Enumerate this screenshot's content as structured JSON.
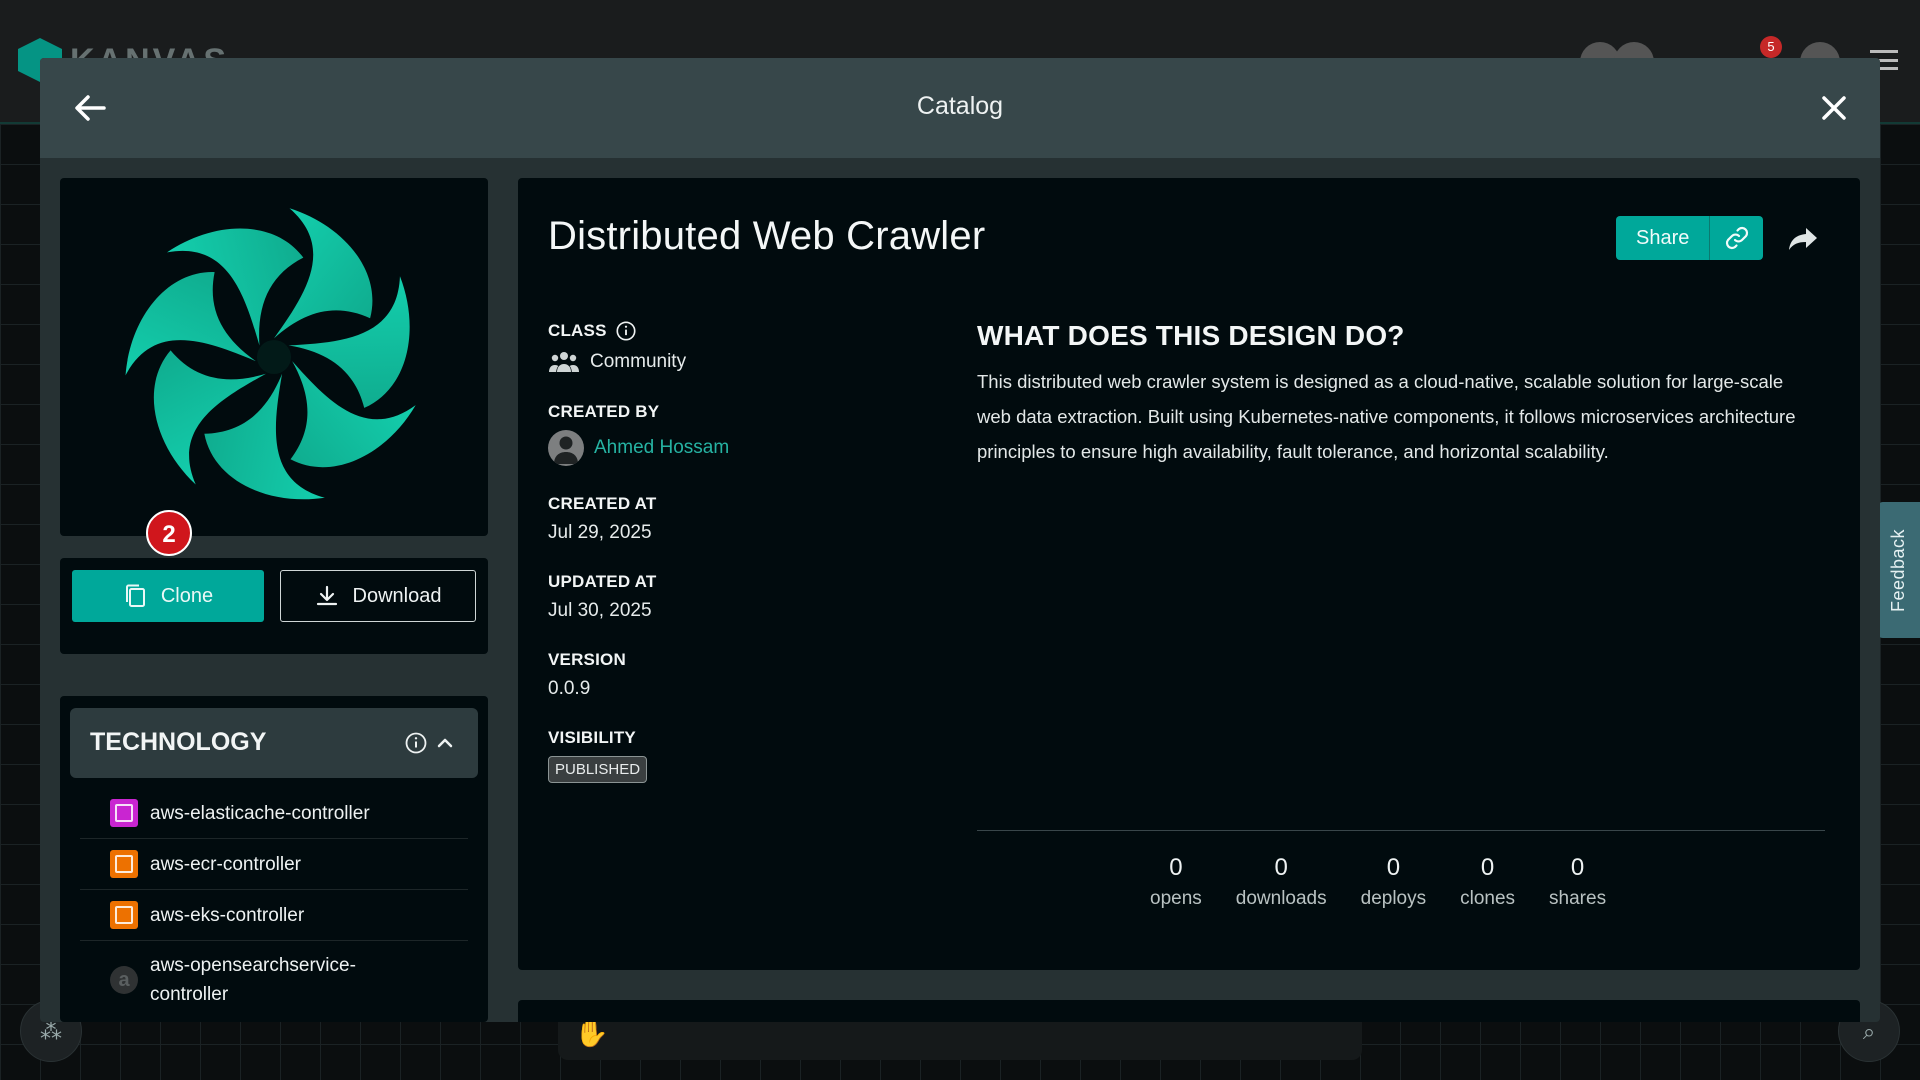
{
  "background": {
    "logo_text": "KANVAS",
    "notification_count": "5"
  },
  "feedback_label": "Feedback",
  "modal": {
    "title": "Catalog",
    "step_badge": "2",
    "actions": {
      "clone_label": "Clone",
      "download_label": "Download"
    },
    "technology": {
      "title": "TECHNOLOGY",
      "items": [
        {
          "label": "aws-elasticache-controller",
          "icon": "elasticache-icon",
          "color": "#c925d1"
        },
        {
          "label": "aws-ecr-controller",
          "icon": "ecr-icon",
          "color": "#ed7100"
        },
        {
          "label": "aws-eks-controller",
          "icon": "eks-icon",
          "color": "#ed7100"
        },
        {
          "label": "aws-opensearchservice-controller",
          "icon": "opensearch-icon",
          "color": "#2f3233"
        }
      ]
    },
    "design": {
      "title": "Distributed Web Crawler",
      "share_label": "Share"
    },
    "meta": {
      "class_label": "CLASS",
      "class_value": "Community",
      "created_by_label": "CREATED BY",
      "created_by_value": "Ahmed Hossam",
      "created_at_label": "CREATED AT",
      "created_at_value": "Jul 29, 2025",
      "updated_at_label": "UPDATED AT",
      "updated_at_value": "Jul 30, 2025",
      "version_label": "VERSION",
      "version_value": "0.0.9",
      "visibility_label": "VISIBILITY",
      "visibility_value": "PUBLISHED"
    },
    "description": {
      "title": "WHAT DOES THIS DESIGN DO?",
      "body": "This distributed web crawler system is designed as a cloud-native, scalable solution for large-scale web data extraction. Built using Kubernetes-native components, it follows microservices architecture principles to ensure high availability, fault tolerance, and horizontal scalability."
    },
    "stats": [
      {
        "value": "0",
        "label": "opens"
      },
      {
        "value": "0",
        "label": "downloads"
      },
      {
        "value": "0",
        "label": "deploys"
      },
      {
        "value": "0",
        "label": "clones"
      },
      {
        "value": "0",
        "label": "shares"
      }
    ]
  },
  "colors": {
    "accent": "#00b39f",
    "accent_dark": "#00a89a",
    "modal_bg": "#263133",
    "header_bg": "#37474a",
    "card_bg": "#010b0e",
    "link": "#26b3a3",
    "badge_red": "#d0161c"
  }
}
